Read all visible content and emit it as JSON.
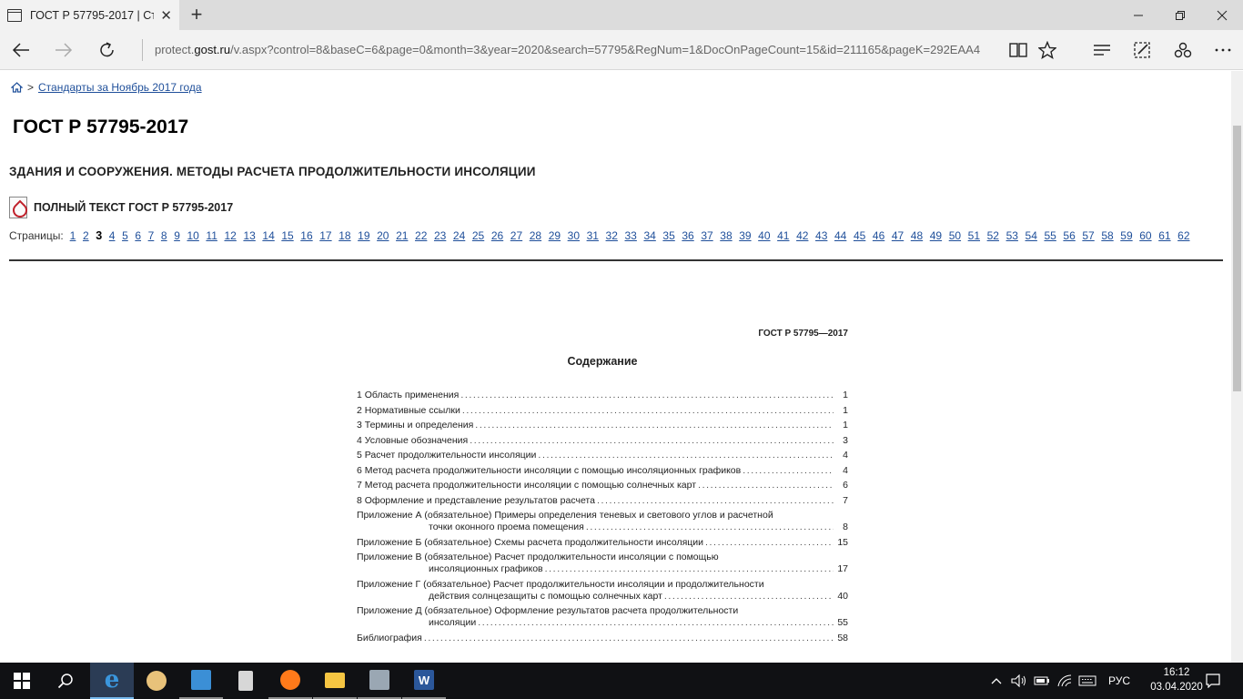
{
  "browser": {
    "tab_title": "ГОСТ Р 57795-2017 | Ст",
    "tab_close": "✕",
    "new_tab": "+",
    "url_prefix": "protect.",
    "url_domain": "gost.ru",
    "url_rest": "/v.aspx?control=8&baseC=6&page=0&month=3&year=2020&search=57795&RegNum=1&DocOnPageCount=15&id=211165&pageK=292EAA4"
  },
  "page": {
    "breadcrumb_sep": ">",
    "breadcrumb_link": "Стандарты за Ноябрь 2017 года",
    "title": "ГОСТ Р 57795-2017",
    "subtitle": "ЗДАНИЯ И СООРУЖЕНИЯ. МЕТОДЫ РАСЧЕТА ПРОДОЛЖИТЕЛЬНОСТИ ИНСОЛЯЦИИ",
    "full_text_link": "ПОЛНЫЙ ТЕКСТ ГОСТ Р 57795-2017",
    "pages_label": "Страницы:",
    "current_page": "3",
    "pages": [
      "1",
      "2",
      "3",
      "4",
      "5",
      "6",
      "7",
      "8",
      "9",
      "10",
      "11",
      "12",
      "13",
      "14",
      "15",
      "16",
      "17",
      "18",
      "19",
      "20",
      "21",
      "22",
      "23",
      "24",
      "25",
      "26",
      "27",
      "28",
      "29",
      "30",
      "31",
      "32",
      "33",
      "34",
      "35",
      "36",
      "37",
      "38",
      "39",
      "40",
      "41",
      "42",
      "43",
      "44",
      "45",
      "46",
      "47",
      "48",
      "49",
      "50",
      "51",
      "52",
      "53",
      "54",
      "55",
      "56",
      "57",
      "58",
      "59",
      "60",
      "61",
      "62"
    ]
  },
  "doc": {
    "header": "ГОСТ Р 57795—2017",
    "title": "Содержание",
    "toc": [
      {
        "text": "1 Область применения",
        "page": "1"
      },
      {
        "text": "2 Нормативные ссылки",
        "page": "1"
      },
      {
        "text": "3 Термины и определения",
        "page": "1"
      },
      {
        "text": "4 Условные обозначения",
        "page": "3"
      },
      {
        "text": "5 Расчет продолжительности инсоляции",
        "page": "4"
      },
      {
        "text": "6 Метод расчета продолжительности инсоляции с помощью инсоляционных графиков",
        "page": "4"
      },
      {
        "text": "7 Метод расчета продолжительности инсоляции с помощью солнечных карт",
        "page": "6"
      },
      {
        "text": "8 Оформление и представление результатов расчета",
        "page": "7"
      },
      {
        "text": "Приложение А (обязательное) Примеры определения теневых и светового углов и расчетной",
        "text2": "точки оконного проема помещения",
        "page": "8"
      },
      {
        "text": "Приложение Б (обязательное) Схемы расчета продолжительности инсоляции",
        "page": "15"
      },
      {
        "text": "Приложение В (обязательное) Расчет продолжительности инсоляции с помощью",
        "text2": "инсоляционных графиков",
        "page": "17"
      },
      {
        "text": "Приложение Г (обязательное) Расчет продолжительности инсоляции и продолжительности",
        "text2": "действия солнцезащиты с помощью солнечных карт",
        "page": "40"
      },
      {
        "text": "Приложение Д (обязательное) Оформление результатов расчета продолжительности",
        "text2": "инсоляции",
        "page": "55"
      },
      {
        "text": "Библиография",
        "page": "58"
      }
    ]
  },
  "taskbar": {
    "lang": "РУС",
    "time": "16:12",
    "date": "03.04.2020"
  }
}
